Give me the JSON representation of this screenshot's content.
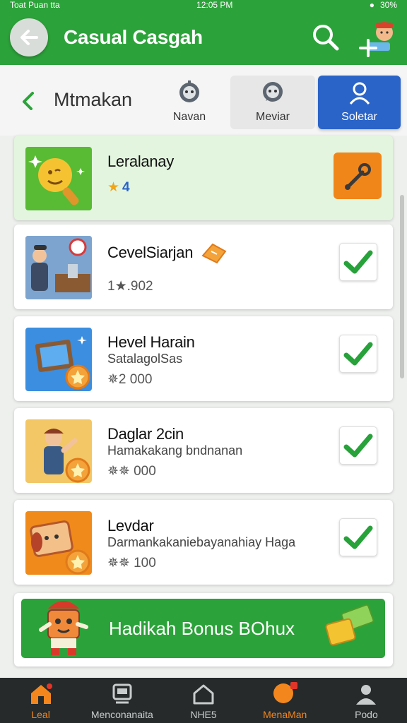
{
  "status": {
    "left": "Toat Puan  tta",
    "time": "12:05 PM",
    "battery": "30%"
  },
  "appbar": {
    "title": "Casual Casgah"
  },
  "header": {
    "title": "Mtmakan",
    "tabs": [
      {
        "label": "Navan"
      },
      {
        "label": "Meviar"
      },
      {
        "label": "Soletar"
      }
    ]
  },
  "items": [
    {
      "title": "Leralanay",
      "subtitle": "",
      "meta": "4"
    },
    {
      "title": "CevelSiarjan",
      "subtitle": "",
      "meta": "1★.902"
    },
    {
      "title": "Hevel Harain",
      "subtitle": "SatalagolSas",
      "meta": "✵2 000"
    },
    {
      "title": "Daglar 2cin",
      "subtitle": "Hamakakang bndnanan",
      "meta": "✵✵ 000"
    },
    {
      "title": "Levdar",
      "subtitle": "Darmankakaniebayanahiay Haga",
      "meta": "✵✵ 100"
    }
  ],
  "bonus": {
    "label": "Hadikah Bonus BOhux"
  },
  "nav": [
    {
      "label": "Leal"
    },
    {
      "label": "Menconanaita"
    },
    {
      "label": "NHE5"
    },
    {
      "label": "MenaMan"
    },
    {
      "label": "Podo"
    }
  ],
  "colors": {
    "primary_green": "#2ca23a",
    "accent_blue": "#2b64c8",
    "accent_orange": "#f3871e"
  }
}
